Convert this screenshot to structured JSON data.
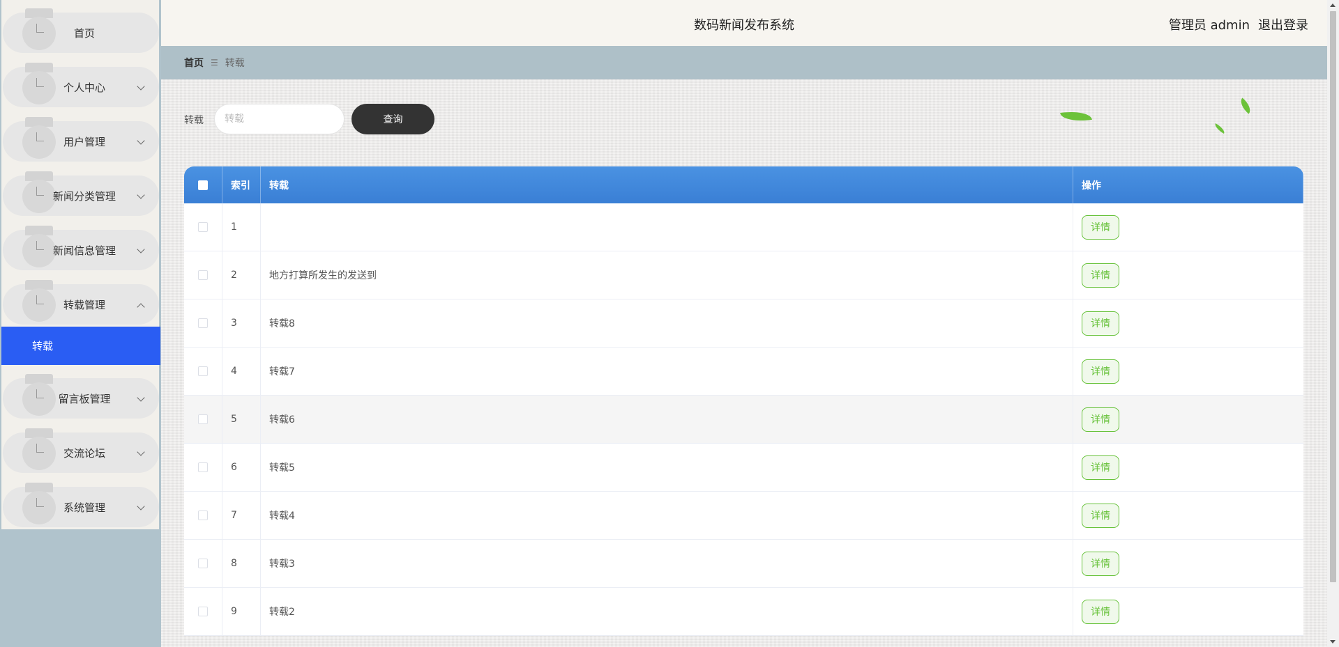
{
  "header": {
    "title": "数码新闻发布系统",
    "user_label": "管理员 admin",
    "logout_label": "退出登录"
  },
  "sidebar": {
    "items": [
      {
        "label": "首页",
        "icon": "menu-icon",
        "has_chevron": false
      },
      {
        "label": "个人中心",
        "icon": "menu-icon",
        "has_chevron": true
      },
      {
        "label": "用户管理",
        "icon": "menu-icon",
        "has_chevron": true
      },
      {
        "label": "新闻分类管理",
        "icon": "menu-icon",
        "has_chevron": true
      },
      {
        "label": "新闻信息管理",
        "icon": "menu-icon",
        "has_chevron": true
      },
      {
        "label": "转载管理",
        "icon": "menu-icon",
        "has_chevron": true,
        "expanded": true
      },
      {
        "label": "留言板管理",
        "icon": "menu-icon",
        "has_chevron": true
      },
      {
        "label": "交流论坛",
        "icon": "menu-icon",
        "has_chevron": true
      },
      {
        "label": "系统管理",
        "icon": "menu-icon",
        "has_chevron": true
      }
    ],
    "active_sub_item": "转载"
  },
  "breadcrumb": {
    "home": "首页",
    "separator": "☰",
    "current": "转载"
  },
  "search": {
    "label": "转载",
    "placeholder": "转载",
    "value": "",
    "button_label": "查询"
  },
  "table": {
    "columns": [
      "索引",
      "转载",
      "操作"
    ],
    "action_label": "详情",
    "rows": [
      {
        "index": "1",
        "content": ""
      },
      {
        "index": "2",
        "content": "地方打算所发生的发送到"
      },
      {
        "index": "3",
        "content": "转载8"
      },
      {
        "index": "4",
        "content": "转载7"
      },
      {
        "index": "5",
        "content": "转载6"
      },
      {
        "index": "6",
        "content": "转载5"
      },
      {
        "index": "7",
        "content": "转载4"
      },
      {
        "index": "8",
        "content": "转载3"
      },
      {
        "index": "9",
        "content": "转载2"
      }
    ]
  },
  "colors": {
    "accent": "#2a5df3",
    "table_header": "#3a7fd5",
    "detail_button": "#67c23a"
  }
}
